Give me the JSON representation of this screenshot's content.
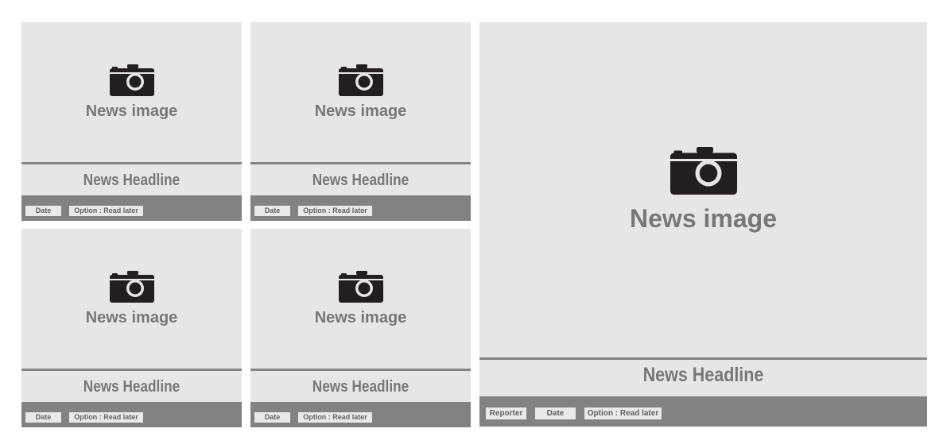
{
  "cards": [
    {
      "image_label": "News image",
      "headline": "News Headline",
      "date_label": "Date",
      "option_label": "Option : Read later"
    },
    {
      "image_label": "News image",
      "headline": "News Headline",
      "date_label": "Date",
      "option_label": "Option : Read later"
    },
    {
      "image_label": "News image",
      "headline": "News Headline",
      "date_label": "Date",
      "option_label": "Option : Read later"
    },
    {
      "image_label": "News image",
      "headline": "News Headline",
      "date_label": "Date",
      "option_label": "Option : Read later"
    }
  ],
  "featured": {
    "image_label": "News image",
    "headline": "News Headline",
    "reporter_label": "Reporter",
    "date_label": "Date",
    "option_label": "Option : Read later"
  },
  "icons": {
    "camera": "camera-icon"
  },
  "colors": {
    "card_background": "#e6e6e6",
    "footer_background": "#828282",
    "text_gray": "#777777",
    "icon_dark": "#231f20"
  }
}
